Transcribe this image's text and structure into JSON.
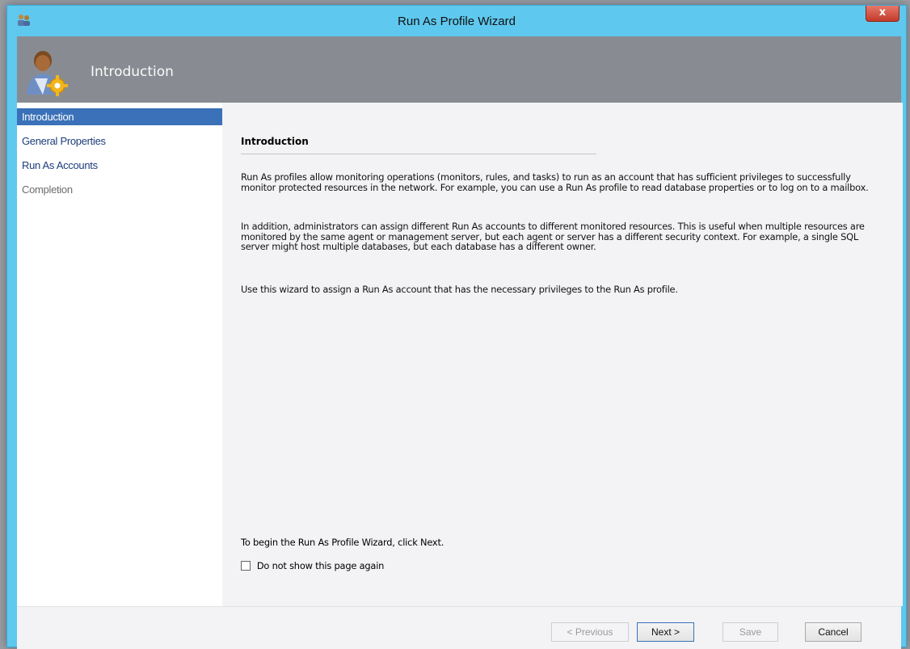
{
  "window": {
    "title": "Run As Profile Wizard",
    "close_label": "x"
  },
  "banner": {
    "title": "Introduction"
  },
  "sidebar": {
    "items": [
      {
        "label": "Introduction",
        "state": "active"
      },
      {
        "label": "General Properties",
        "state": "normal"
      },
      {
        "label": "Run As Accounts",
        "state": "normal"
      },
      {
        "label": "Completion",
        "state": "disabled"
      }
    ]
  },
  "content": {
    "section_title": "Introduction",
    "paragraphs": [
      "Run As profiles allow monitoring operations (monitors, rules, and tasks) to run as an account that has sufficient privileges to successfully monitor protected resources in the network. For example, you can use a Run As profile to read database properties or to log on to a mailbox.",
      "In addition, administrators can assign different Run As accounts to different monitored resources. This is useful when multiple resources are monitored by the same agent or management server, but each agent or server has a different security context. For example, a single SQL server might host multiple databases, but each database has a different owner.",
      "Use this wizard to assign a Run As account that has the necessary privileges to the Run As profile."
    ],
    "begin_text": "To begin the Run As Profile Wizard, click Next.",
    "checkbox_label": "Do not show this page again",
    "checkbox_checked": false
  },
  "buttons": {
    "previous": "< Previous",
    "next": "Next >",
    "save": "Save",
    "cancel": "Cancel"
  },
  "colors": {
    "title_bar": "#5fc8ee",
    "banner": "#888c92",
    "nav_selected": "#3a71b8",
    "nav_text": "#1d3c7a"
  }
}
